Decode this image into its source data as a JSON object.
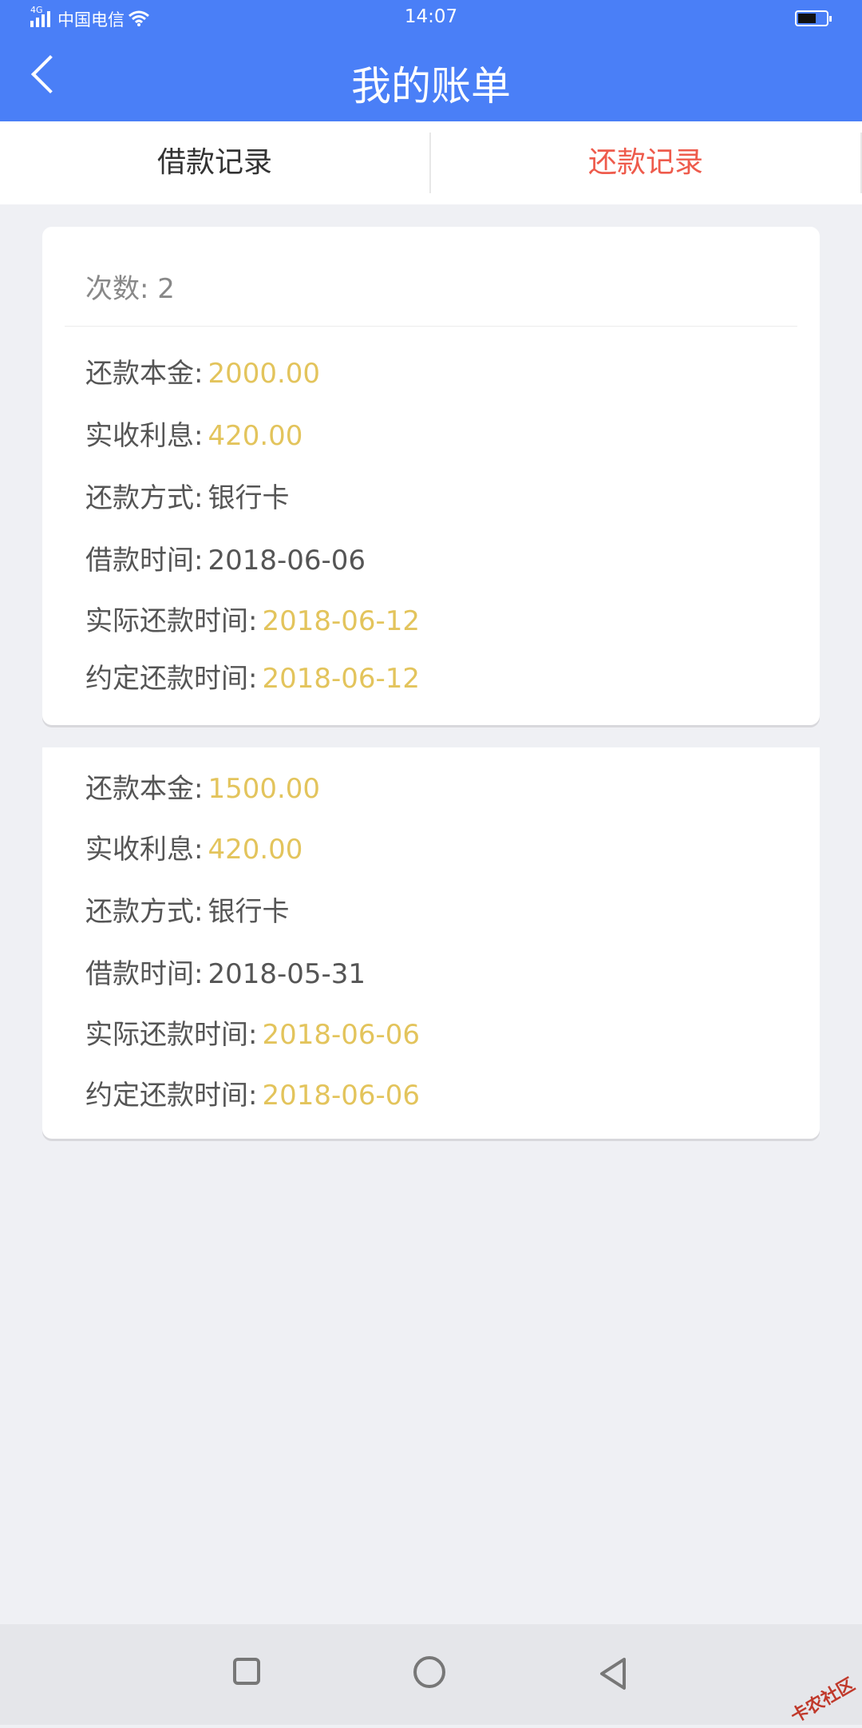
{
  "status": {
    "carrier": "中国电信",
    "network": "4G",
    "time": "14:07"
  },
  "header": {
    "title": "我的账单"
  },
  "tabs": [
    {
      "label": "借款记录",
      "active": false
    },
    {
      "label": "还款记录",
      "active": true
    }
  ],
  "colors": {
    "accent": "#4a7ff7",
    "active_tab": "#ee5b4c",
    "highlight": "#e3c45c"
  },
  "records": [
    {
      "count_label": "次数: 2",
      "rows": [
        {
          "label": "还款本金:",
          "value": "2000.00"
        },
        {
          "label": "实收利息:",
          "value": "420.00"
        },
        {
          "label": "还款方式:",
          "value": "银行卡"
        },
        {
          "label": "借款时间:",
          "value": "2018-06-06"
        },
        {
          "label": "实际还款时间:",
          "value": "2018-06-12"
        },
        {
          "label": "约定还款时间:",
          "value": "2018-06-12"
        }
      ]
    },
    {
      "rows": [
        {
          "label": "还款本金:",
          "value": "1500.00"
        },
        {
          "label": "实收利息:",
          "value": "420.00"
        },
        {
          "label": "还款方式:",
          "value": "银行卡"
        },
        {
          "label": "借款时间:",
          "value": "2018-05-31"
        },
        {
          "label": "实际还款时间:",
          "value": "2018-06-06"
        },
        {
          "label": "约定还款时间:",
          "value": "2018-06-06"
        }
      ]
    }
  ],
  "navbar": {
    "icons": [
      "square-icon",
      "circle-icon",
      "back-triangle-icon"
    ]
  },
  "watermark": "卡农社区"
}
